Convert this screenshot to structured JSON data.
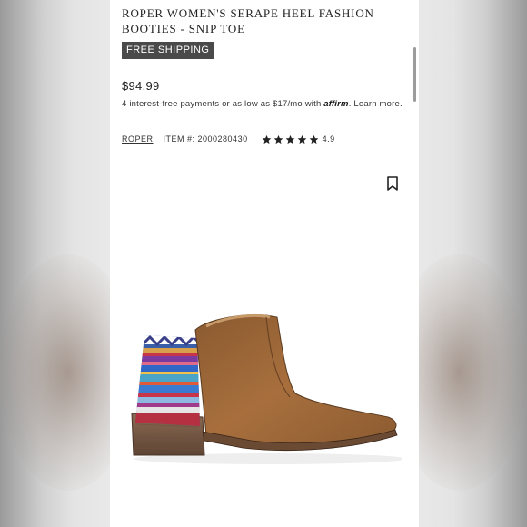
{
  "product": {
    "title": "ROPER WOMEN'S SERAPE HEEL FASHION BOOTIES - SNIP TOE",
    "shipping_badge": "FREE SHIPPING",
    "price": "$94.99",
    "installments_prefix": "4 interest-free payments or as low as $17/mo with ",
    "affirm_logo": "affirm",
    "installments_suffix": ". ",
    "learn_more": "Learn more.",
    "brand": "ROPER",
    "item_number": "ITEM #: 2000280430",
    "rating_stars": 5,
    "rating": "4.9",
    "bookmark_icon": "bookmark-icon",
    "image_alt": "brown leather ankle bootie with serape heel"
  },
  "colors": {
    "badge_bg": "#4a4a4a",
    "boot_leather": "#9a6536",
    "heel_wood": "#7a5a44"
  }
}
